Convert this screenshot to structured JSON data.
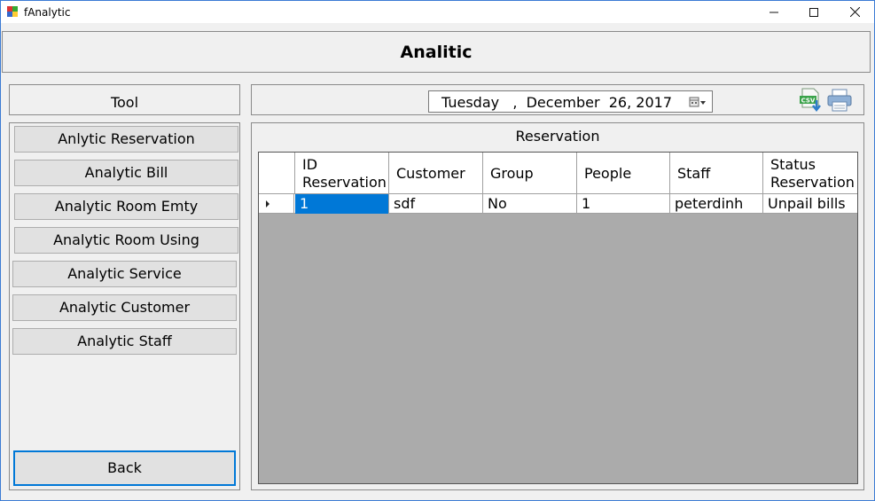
{
  "window": {
    "title": "fAnalytic",
    "icon": "app-icon",
    "controls": {
      "minimize": "minimize-icon",
      "maximize": "maximize-icon",
      "close": "close-icon"
    }
  },
  "header": {
    "title": "Analitic"
  },
  "tool": {
    "label": "Tool",
    "buttons": [
      "Anlytic Reservation",
      "Analytic Bill",
      "Analytic Room Emty",
      "Analytic Room Using",
      "Analytic Service",
      "Analytic Customer",
      "Analytic Staff"
    ],
    "back": "Back"
  },
  "date_bar": {
    "date": "Tuesday   ,  December  26, 2017",
    "csv_icon": "csv-export-icon",
    "print_icon": "printer-icon"
  },
  "reservation": {
    "title": "Reservation",
    "columns": [
      "ID Reservation",
      "Customer",
      "Group",
      "People",
      "Staff",
      "Status Reservation"
    ],
    "rows": [
      [
        "1",
        "sdf",
        "No",
        "1",
        "peterdinh",
        "Unpail bills"
      ]
    ]
  },
  "colors": {
    "accent": "#0078d7",
    "grid_bg": "#ababab",
    "window_bg": "#f0f0f0"
  }
}
